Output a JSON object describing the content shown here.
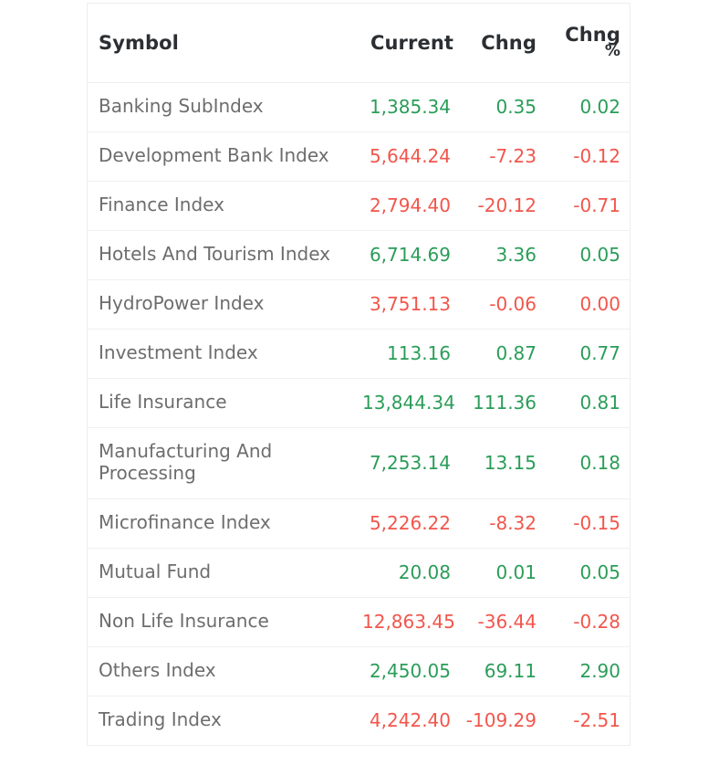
{
  "table": {
    "columns": [
      {
        "key": "symbol",
        "label": "Symbol",
        "align": "left"
      },
      {
        "key": "current",
        "label": "Current",
        "align": "right"
      },
      {
        "key": "chng",
        "label": "Chng",
        "align": "right"
      },
      {
        "key": "chng_pct_line1",
        "label": "Chng",
        "label_line2": "%",
        "align": "right"
      }
    ],
    "colors": {
      "up": "#2a9d58",
      "down": "#f2564c",
      "symbol_text": "#6d6d6d",
      "header_text": "#2b2f33",
      "border": "#eceef0",
      "row_divider": "#eff0f2",
      "background": "#ffffff"
    },
    "rows": [
      {
        "symbol": "Banking SubIndex",
        "current": "1,385.34",
        "chng": "0.35",
        "chng_pct": "0.02",
        "direction": "up"
      },
      {
        "symbol": "Development Bank Index",
        "current": "5,644.24",
        "chng": "-7.23",
        "chng_pct": "-0.12",
        "direction": "down"
      },
      {
        "symbol": "Finance Index",
        "current": "2,794.40",
        "chng": "-20.12",
        "chng_pct": "-0.71",
        "direction": "down"
      },
      {
        "symbol": "Hotels And Tourism Index",
        "current": "6,714.69",
        "chng": "3.36",
        "chng_pct": "0.05",
        "direction": "up"
      },
      {
        "symbol": "HydroPower Index",
        "current": "3,751.13",
        "chng": "-0.06",
        "chng_pct": "0.00",
        "direction": "down"
      },
      {
        "symbol": "Investment Index",
        "current": "113.16",
        "chng": "0.87",
        "chng_pct": "0.77",
        "direction": "up"
      },
      {
        "symbol": "Life Insurance",
        "current": "13,844.34",
        "chng": "111.36",
        "chng_pct": "0.81",
        "direction": "up"
      },
      {
        "symbol": "Manufacturing And Processing",
        "current": "7,253.14",
        "chng": "13.15",
        "chng_pct": "0.18",
        "direction": "up"
      },
      {
        "symbol": "Microfinance Index",
        "current": "5,226.22",
        "chng": "-8.32",
        "chng_pct": "-0.15",
        "direction": "down"
      },
      {
        "symbol": "Mutual Fund",
        "current": "20.08",
        "chng": "0.01",
        "chng_pct": "0.05",
        "direction": "up"
      },
      {
        "symbol": "Non Life Insurance",
        "current": "12,863.45",
        "chng": "-36.44",
        "chng_pct": "-0.28",
        "direction": "down"
      },
      {
        "symbol": "Others Index",
        "current": "2,450.05",
        "chng": "69.11",
        "chng_pct": "2.90",
        "direction": "up"
      },
      {
        "symbol": "Trading Index",
        "current": "4,242.40",
        "chng": "-109.29",
        "chng_pct": "-2.51",
        "direction": "down"
      }
    ]
  }
}
